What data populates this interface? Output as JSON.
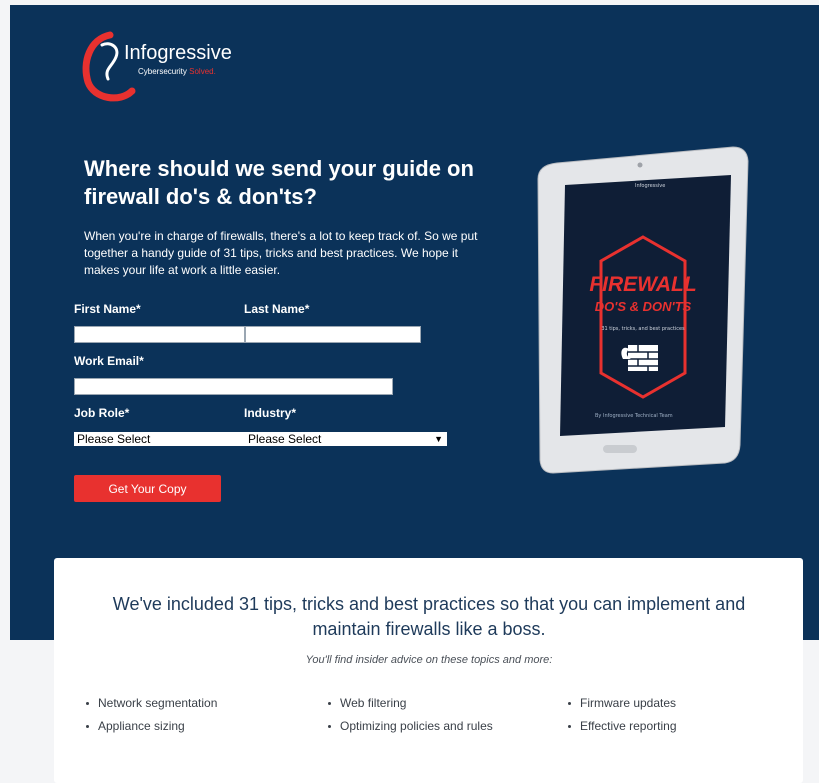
{
  "brand": {
    "name": "Infogressive",
    "tagline_prefix": "Cybersecurity",
    "tagline_suffix": "Solved."
  },
  "hero": {
    "headline": "Where should we send your guide on firewall do's & don'ts?",
    "intro": "When you're in charge of firewalls, there's a lot to keep track of. So we put together a handy guide of 31 tips, tricks and best practices. We hope it makes your life at work a little easier."
  },
  "form": {
    "first_name_label": "First Name*",
    "last_name_label": "Last Name*",
    "email_label": "Work Email*",
    "job_role_label": "Job Role*",
    "industry_label": "Industry*",
    "job_role_value": "Please Select",
    "industry_value": "Please Select",
    "submit_label": "Get Your Copy"
  },
  "tablet": {
    "cover_brand": "Infogressive",
    "cover_title_1": "FIREWALL",
    "cover_title_2": "DO'S & DON'TS",
    "cover_subtitle": "31 tips, tricks, and best practices",
    "cover_author": "By Infogressive Technical Team"
  },
  "info_card": {
    "title": "We've included 31 tips, tricks and best practices so that you can implement and maintain firewalls like a boss.",
    "subtitle": "You'll find insider advice on these topics and more:",
    "columns": [
      [
        "Network segmentation",
        "Appliance sizing"
      ],
      [
        "Web filtering",
        "Optimizing policies and rules"
      ],
      [
        "Firmware updates",
        "Effective reporting"
      ]
    ]
  },
  "colors": {
    "hero_bg": "#0b3259",
    "accent_red": "#e8312f",
    "page_bg": "#f4f5f7"
  }
}
